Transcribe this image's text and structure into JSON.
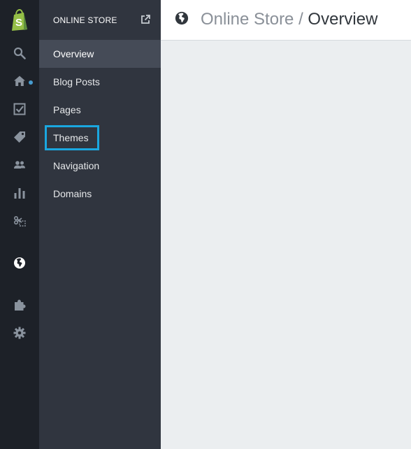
{
  "rail": {
    "icons": [
      "shopify-logo",
      "search-icon",
      "home-icon",
      "orders-icon",
      "products-icon",
      "customers-icon",
      "reports-icon",
      "discounts-icon",
      "online-store-icon",
      "apps-icon",
      "settings-icon"
    ],
    "active": "online-store-icon",
    "notification_dot_color": "#479ccf"
  },
  "subnav": {
    "title": "ONLINE STORE",
    "items": [
      {
        "label": "Overview",
        "active": true
      },
      {
        "label": "Blog Posts",
        "active": false
      },
      {
        "label": "Pages",
        "active": false
      },
      {
        "label": "Themes",
        "active": false,
        "highlighted": true
      },
      {
        "label": "Navigation",
        "active": false
      },
      {
        "label": "Domains",
        "active": false
      }
    ]
  },
  "header": {
    "parent": "Online Store",
    "separator": "/",
    "current": "Overview"
  },
  "colors": {
    "rail_bg": "#1d2128",
    "subnav_bg": "#30353f",
    "active_item_bg": "#454b57",
    "highlight": "#1aa7e0",
    "shopify_green": "#95bf47",
    "content_bg": "#ebeef0"
  }
}
